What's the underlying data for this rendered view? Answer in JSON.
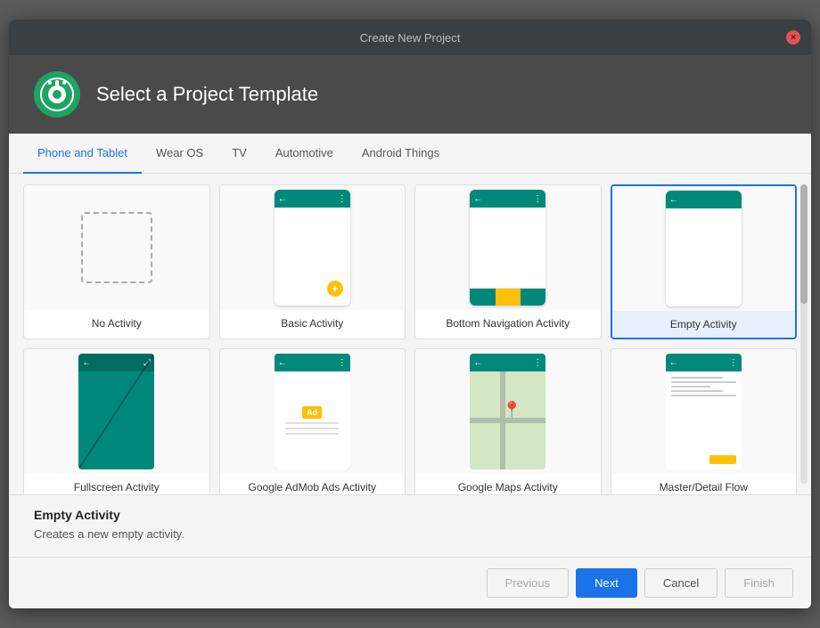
{
  "titleBar": {
    "title": "Create New Project",
    "closeIcon": "×"
  },
  "header": {
    "title": "Select a Project Template"
  },
  "tabs": [
    {
      "id": "phone",
      "label": "Phone and Tablet",
      "active": true
    },
    {
      "id": "wear",
      "label": "Wear OS",
      "active": false
    },
    {
      "id": "tv",
      "label": "TV",
      "active": false
    },
    {
      "id": "auto",
      "label": "Automotive",
      "active": false
    },
    {
      "id": "things",
      "label": "Android Things",
      "active": false
    }
  ],
  "templates": [
    {
      "id": "no-activity",
      "label": "No Activity",
      "selected": false
    },
    {
      "id": "basic-activity",
      "label": "Basic Activity",
      "selected": false
    },
    {
      "id": "bottom-nav",
      "label": "Bottom Navigation Activity",
      "selected": false
    },
    {
      "id": "empty-activity",
      "label": "Empty Activity",
      "selected": true
    },
    {
      "id": "fullscreen",
      "label": "Fullscreen Activity",
      "selected": false
    },
    {
      "id": "ads",
      "label": "Google AdMob Ads Activity",
      "selected": false
    },
    {
      "id": "maps",
      "label": "Google Maps Activity",
      "selected": false
    },
    {
      "id": "master-detail",
      "label": "Master/Detail Flow",
      "selected": false
    }
  ],
  "selectedInfo": {
    "title": "Empty Activity",
    "description": "Creates a new empty activity."
  },
  "footer": {
    "previousLabel": "Previous",
    "nextLabel": "Next",
    "cancelLabel": "Cancel",
    "finishLabel": "Finish"
  }
}
